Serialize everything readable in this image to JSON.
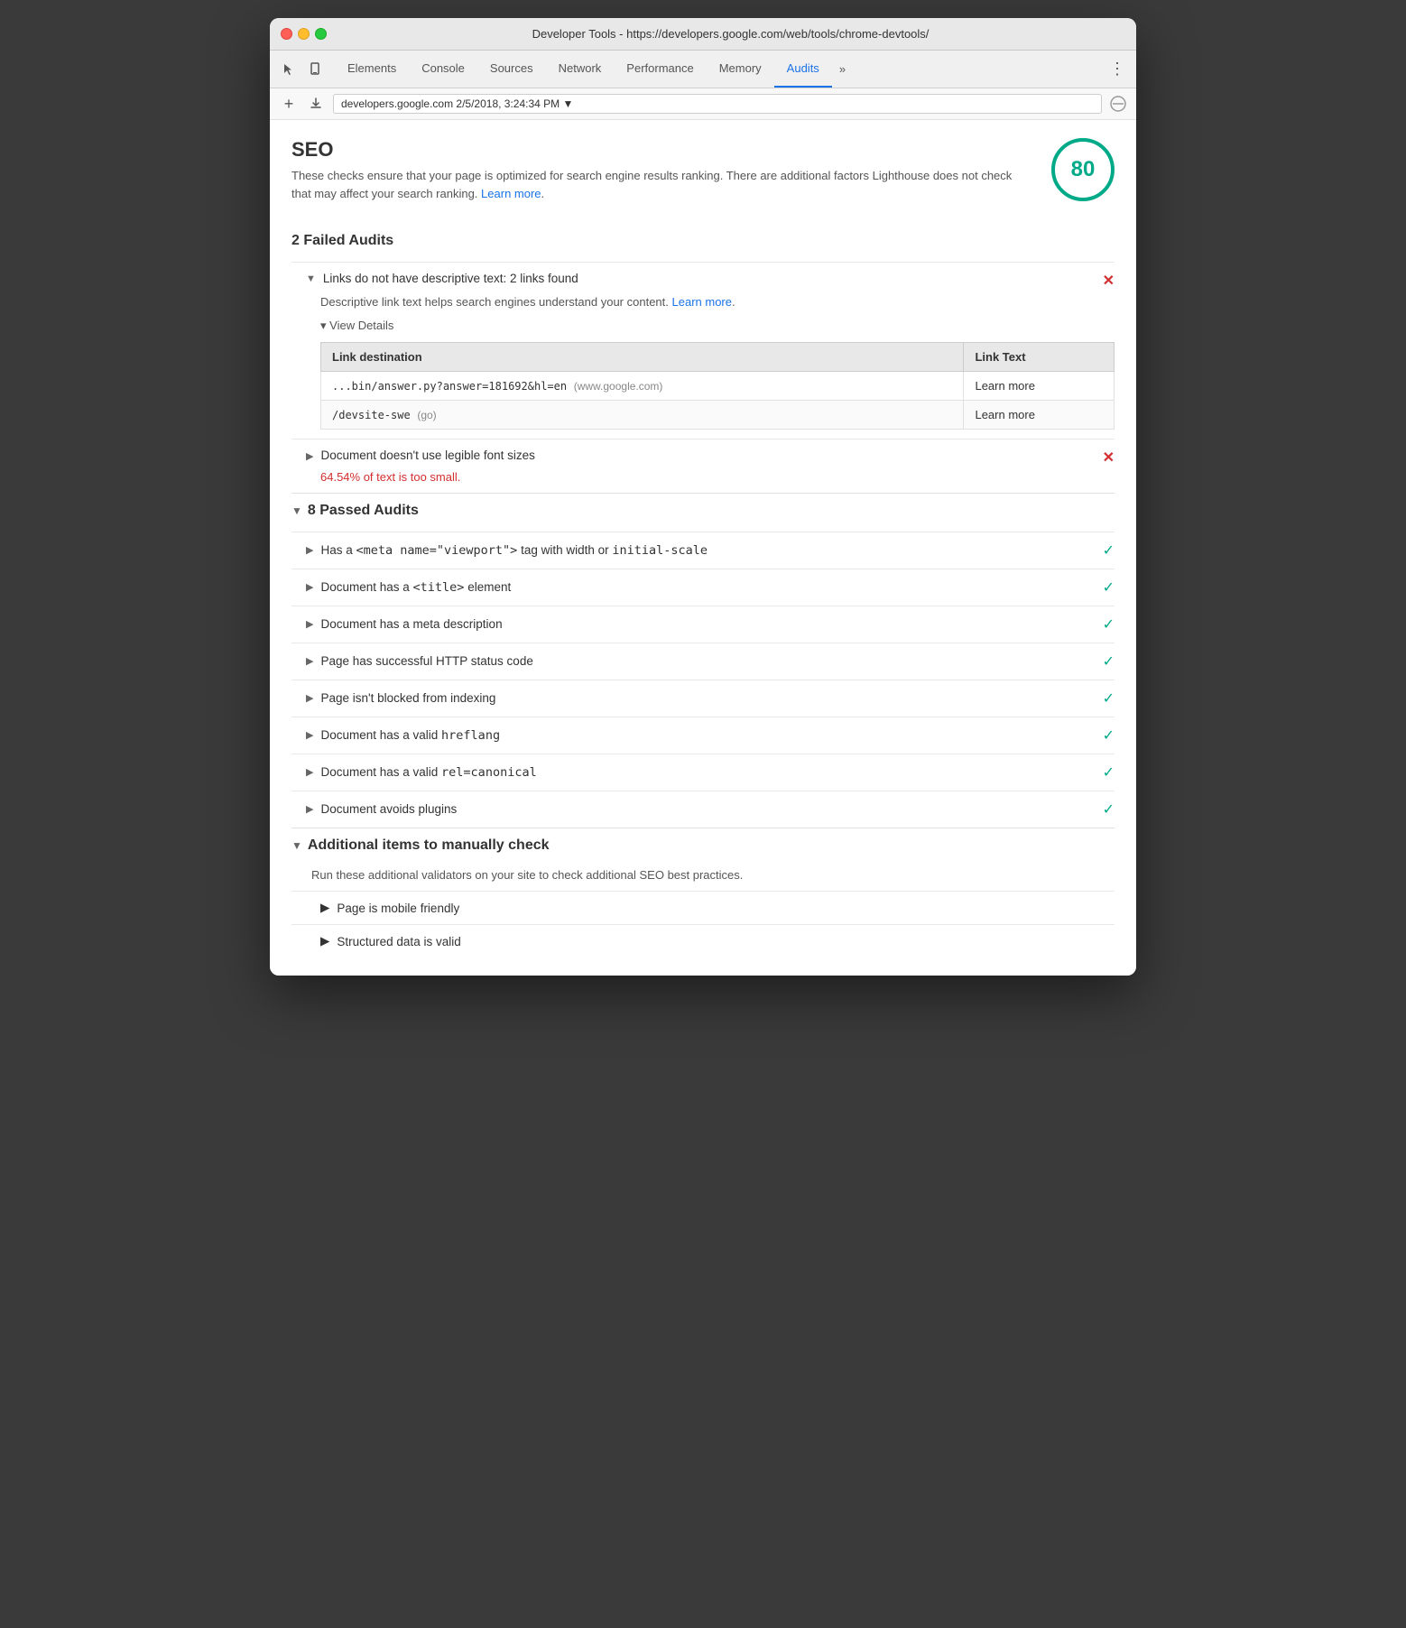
{
  "window": {
    "title": "Developer Tools - https://developers.google.com/web/tools/chrome-devtools/"
  },
  "titlebar": {
    "title": "Developer Tools - https://developers.google.com/web/tools/chrome-devtools/"
  },
  "tabs": {
    "items": [
      {
        "label": "Elements",
        "active": false
      },
      {
        "label": "Console",
        "active": false
      },
      {
        "label": "Sources",
        "active": false
      },
      {
        "label": "Network",
        "active": false
      },
      {
        "label": "Performance",
        "active": false
      },
      {
        "label": "Memory",
        "active": false
      },
      {
        "label": "Audits",
        "active": true
      }
    ],
    "more_label": "»"
  },
  "addressbar": {
    "value": "developers.google.com 2/5/2018, 3:24:34 PM ▼"
  },
  "seo": {
    "title": "SEO",
    "description": "These checks ensure that your page is optimized for search engine results ranking. There are additional factors Lighthouse does not check that may affect your search ranking.",
    "learn_more": "Learn more",
    "score": "80"
  },
  "failed_audits": {
    "section_title": "2 Failed Audits",
    "items": [
      {
        "title": "Links do not have descriptive text: 2 links found",
        "description": "Descriptive link text helps search engines understand your content.",
        "learn_more": "Learn more",
        "learn_more_link": true,
        "view_details_label": "▾ View Details",
        "table": {
          "headers": [
            "Link destination",
            "Link Text"
          ],
          "rows": [
            {
              "destination": "...bin/answer.py?answer=181692&hl=en",
              "destination_sub": "(www.google.com)",
              "link_text": "Learn more"
            },
            {
              "destination": "/devsite-swe",
              "destination_sub": "(go)",
              "link_text": "Learn more"
            }
          ]
        }
      },
      {
        "title": "Document doesn't use legible font sizes",
        "fail_text": "64.54% of text is too small.",
        "expanded": false
      }
    ]
  },
  "passed_audits": {
    "section_title": "8 Passed Audits",
    "items": [
      {
        "label": "Has a <meta name=\"viewport\"> tag with width or initial-scale"
      },
      {
        "label": "Document has a <title> element"
      },
      {
        "label": "Document has a meta description"
      },
      {
        "label": "Page has successful HTTP status code"
      },
      {
        "label": "Page isn't blocked from indexing"
      },
      {
        "label": "Document has a valid hreflang"
      },
      {
        "label": "Document has a valid rel=canonical"
      },
      {
        "label": "Document avoids plugins"
      }
    ]
  },
  "additional_items": {
    "section_title": "Additional items to manually check",
    "description": "Run these additional validators on your site to check additional SEO best practices.",
    "items": [
      {
        "label": "Page is mobile friendly"
      },
      {
        "label": "Structured data is valid"
      }
    ]
  },
  "icons": {
    "cursor": "⬚",
    "mobile": "□",
    "close": "✕",
    "minimize": "−",
    "maximize": "+"
  }
}
